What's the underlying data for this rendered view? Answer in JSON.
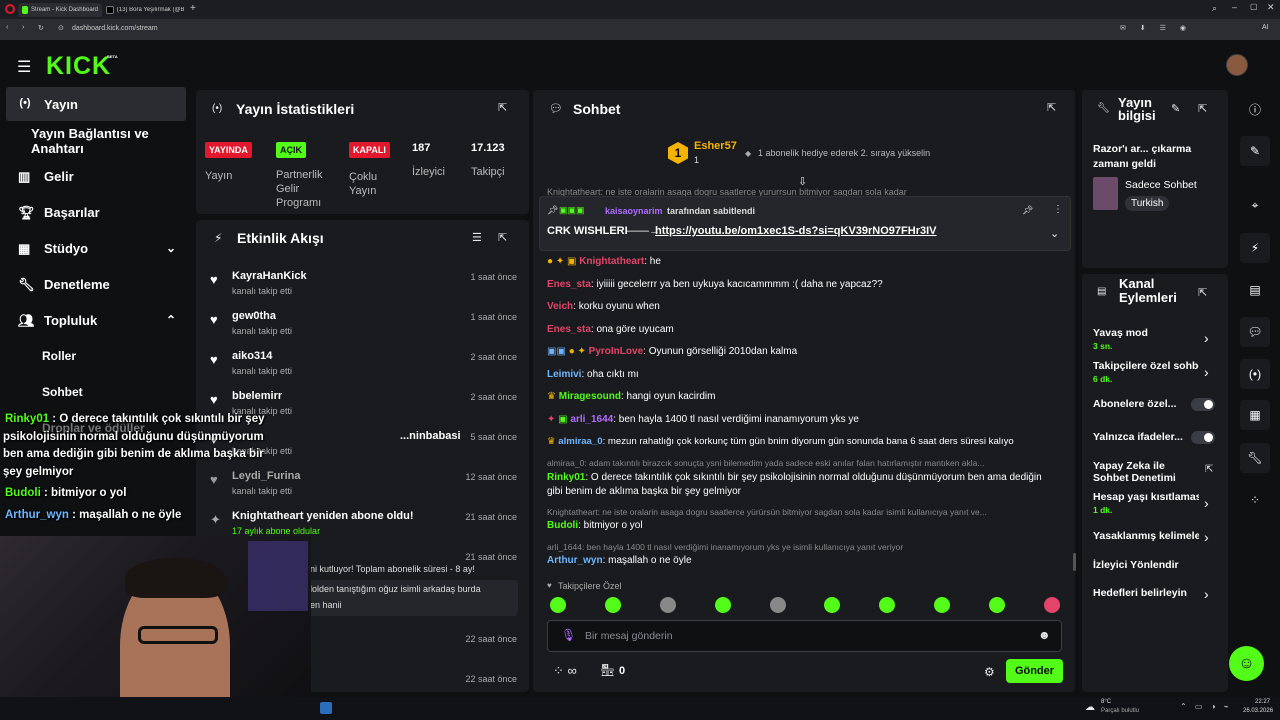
{
  "browser": {
    "tabs": [
      {
        "label": "Stream - Kick Dashboard",
        "active": true
      },
      {
        "label": "(13) Bora Yeşilırmak (@Bo",
        "active": false
      }
    ],
    "url": "dashboard.kick.com/stream",
    "ai_label": "AI"
  },
  "header": {
    "logo": "KICK",
    "beta": "BETA"
  },
  "sidebar": {
    "items": [
      {
        "label": "Yayın"
      },
      {
        "label": "Yayın Bağlantısı ve Anahtarı"
      },
      {
        "label": "Gelir"
      },
      {
        "label": "Başarılar"
      },
      {
        "label": "Stüdyo"
      },
      {
        "label": "Denetleme"
      },
      {
        "label": "Topluluk"
      },
      {
        "label": "Roller"
      },
      {
        "label": "Sohbet"
      },
      {
        "label": "Droplar ve ödüller"
      }
    ]
  },
  "stats": {
    "title": "Yayın İstatistikleri",
    "items": [
      {
        "badge": "YAYINDA",
        "label": "Yayın",
        "color": "#e3182d"
      },
      {
        "badge": "AÇIK",
        "label": "Partnerlik Gelir Programı",
        "color": "#53fc18"
      },
      {
        "badge": "KAPALI",
        "label": "Çoklu Yayın",
        "color": "#e3182d"
      },
      {
        "value": "187",
        "label": "İzleyici"
      },
      {
        "value": "17.123",
        "label": "Takipçi"
      }
    ]
  },
  "activity": {
    "title": "Etkinlik Akışı",
    "items": [
      {
        "name": "KayraHanKick",
        "sub": "kanalı takip etti",
        "time": "1 saat önce"
      },
      {
        "name": "gew0tha",
        "sub": "kanalı takip etti",
        "time": "1 saat önce"
      },
      {
        "name": "aiko314",
        "sub": "kanalı takip etti",
        "time": "2 saat önce"
      },
      {
        "name": "bbelemirr",
        "sub": "kanalı takip etti",
        "time": "2 saat önce"
      },
      {
        "name": "...ninbabasi",
        "sub": "kanalı takip etti",
        "time": "5 saat önce"
      },
      {
        "name": "Leydi_Furina",
        "sub": "kanalı takip etti",
        "time": "12 saat önce"
      },
      {
        "name": "Knightatheart yeniden abone oldu!",
        "sub": "17 aylık abone oldular",
        "time": "21 saat önce"
      },
      {
        "name": "",
        "sub": "",
        "time": "21 saat önce"
      },
      {
        "name": "",
        "sub": "",
        "time": "22 saat önce"
      },
      {
        "name": "",
        "sub": "",
        "time": "22 saat önce"
      }
    ],
    "sub_msg": "ni kutluyor! Toplam abonelik süresi - 8 ay!",
    "sub_msg2": "lolden tanıştığım oğuz isimli arkadaş burda",
    "sub_msg3": "en hanii"
  },
  "chat": {
    "title": "Sohbet",
    "top_gifter": {
      "name": "Esher57",
      "count": "1",
      "rank": "1",
      "message": "1 abonelik hediye ederek 2. sıraya yükselin"
    },
    "cut_line": "Knightatheart: ne iste oralarin asaga dogru saatlerce yururrsun bitmiyor sagdan sola kadar",
    "pinned": {
      "user": "kaisaoynarim",
      "suffix": "tarafından sabitlendi",
      "text": "CRK WISHLERI",
      "arrow": "——→",
      "link": "https://youtu.be/om1xec1S-ds?si=qKV39rNO97FHr3IV"
    },
    "messages": [
      {
        "user": "Knightatheart",
        "color": "#e3456a",
        "text": ": he"
      },
      {
        "user": "Enes_sta",
        "color": "#e3456a",
        "text": ": iyiiiii gecelerrr ya ben uykuya kacıcammmm :( daha ne yapcaz??"
      },
      {
        "user": "Veich",
        "color": "#e3456a",
        "text": ": korku oyunu when"
      },
      {
        "user": "Enes_sta",
        "color": "#e3456a",
        "text": ": ona göre uyucam"
      },
      {
        "user": "PyroInLove",
        "color": "#e3456a",
        "text": ": Oyunun görselliği 2010dan kalma"
      },
      {
        "user": "Leimivi",
        "color": "#6fb6ff",
        "text": ": oha cıktı mı"
      },
      {
        "user": "Miragesound",
        "color": "#53fc18",
        "text": ": hangi oyun kacirdim"
      },
      {
        "user": "arli_1644",
        "color": "#b06cff",
        "text": ": ben hayla 1400 tl nasıl verdiğimi inanamıyorum yks ye"
      },
      {
        "user": "almiraa_0",
        "color": "#6fb6ff",
        "text": ": mezun rahatlığı çok korkunç tüm gün bnim diyorum gün sonunda bana 6 saat ders süresi kalıyo"
      }
    ],
    "reply1": "almiraa_0: adam takıntılı birazcık sonuçta ysni bilemedim yada sadece eski anılar falan hatırlamıştır mantıken akla...",
    "msg_rinky_user": "Rinky01",
    "msg_rinky": ": O derece takıntılık çok sıkıntılı bir şey psikolojisinin normal olduğunu düşünmüyorum ben ama dediğin",
    "msg_rinky2": "gibi benim de aklıma başka bir şey gelmiyor",
    "reply2": "Knightatheart: ne iste oralarin asaga dogru saatlerce yürürsün bitmiyor sagdan sola kadar isimli kullanıcıya yanıt ve...",
    "msg_budoli_user": "Budoli",
    "msg_budoli": ": bitmiyor o yol",
    "reply3": "arli_1644: ben hayla 1400 tl nasıl verdiğimi inanamıyorum yks ye isimli kullanıcıya yanıt veriyor",
    "msg_arthur_user": "Arthur_wyn",
    "msg_arthur": ": maşallah o ne öyle",
    "followers_only": "Takipçilere Özel",
    "placeholder": "Bir mesaj gönderin",
    "points": "0",
    "send": "Gönder"
  },
  "stream_info": {
    "title": "Yayın bilgisi",
    "stream_title": "Razor'ı ar... çıkarma zamanı geldi",
    "category": "Sadece Sohbet",
    "tag": "Turkish"
  },
  "channel_actions": {
    "title": "Kanal Eylemleri",
    "items": [
      {
        "label": "Yavaş mod",
        "sub": "3 sn.",
        "kind": "chevron"
      },
      {
        "label": "Takipçilere özel sohbet",
        "sub": "6 dk.",
        "kind": "chevron"
      },
      {
        "label": "Abonelere özel...",
        "sub": "",
        "kind": "toggle"
      },
      {
        "label": "Yalnızca ifadeler...",
        "sub": "",
        "kind": "toggle"
      },
      {
        "label": "Yapay Zeka ile Sohbet Denetimi",
        "sub": "",
        "kind": "external"
      },
      {
        "label": "Hesap yaşı kısıtlaması",
        "sub": "1 dk.",
        "kind": "chevron"
      },
      {
        "label": "Yasaklanmış kelimeler",
        "sub": "",
        "kind": "chevron"
      },
      {
        "label": "İzleyici Yönlendir",
        "sub": "",
        "kind": "none"
      },
      {
        "label": "Hedefleri belirleyin",
        "sub": "",
        "kind": "chevron"
      }
    ]
  },
  "overlay": {
    "lines": [
      {
        "user": "Rinky01",
        "text": " : O derece takıntılık çok sıkıntılı bir şey"
      },
      {
        "user": "",
        "text": "psikolojisinin normal olduğunu düşünmüyorum"
      },
      {
        "user": "",
        "text": "ben ama dediğin gibi benim de aklıma başka bir"
      },
      {
        "user": "",
        "text": "şey gelmiyor"
      },
      {
        "user": "Budoli",
        "text": " : bitmiyor o yol"
      },
      {
        "user": "Arthur_wyn",
        "text": " : maşallah o ne öyle"
      }
    ]
  },
  "taskbar": {
    "weather_temp": "8°C",
    "weather_desc": "Parçalı bulutlu",
    "time": "22:27",
    "date": "26.03.2026"
  },
  "colors": {
    "accent": "#53fc18",
    "live": "#e3182d",
    "panel": "#191b1f"
  }
}
